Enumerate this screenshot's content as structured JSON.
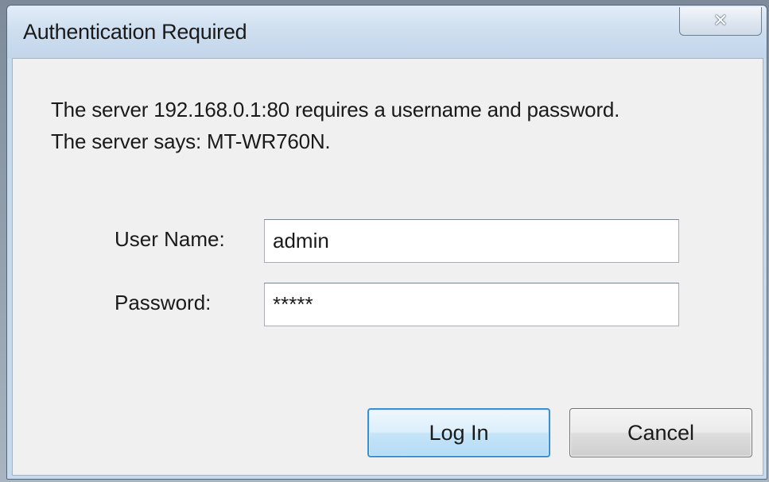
{
  "dialog": {
    "title": "Authentication Required",
    "close_glyph": "✕",
    "message_line1": "The server 192.168.0.1:80 requires a username and password.",
    "message_line2": "The server says: MT-WR760N."
  },
  "form": {
    "username_label": "User Name:",
    "username_value": "admin",
    "password_label": "Password:",
    "password_value": "*****"
  },
  "buttons": {
    "login_label": "Log In",
    "cancel_label": "Cancel"
  },
  "icons": {
    "close": "close-icon"
  },
  "colors": {
    "titlebar": "#cfdff0",
    "client": "#f0f0f0",
    "default_button_border": "#3c8fd1"
  }
}
